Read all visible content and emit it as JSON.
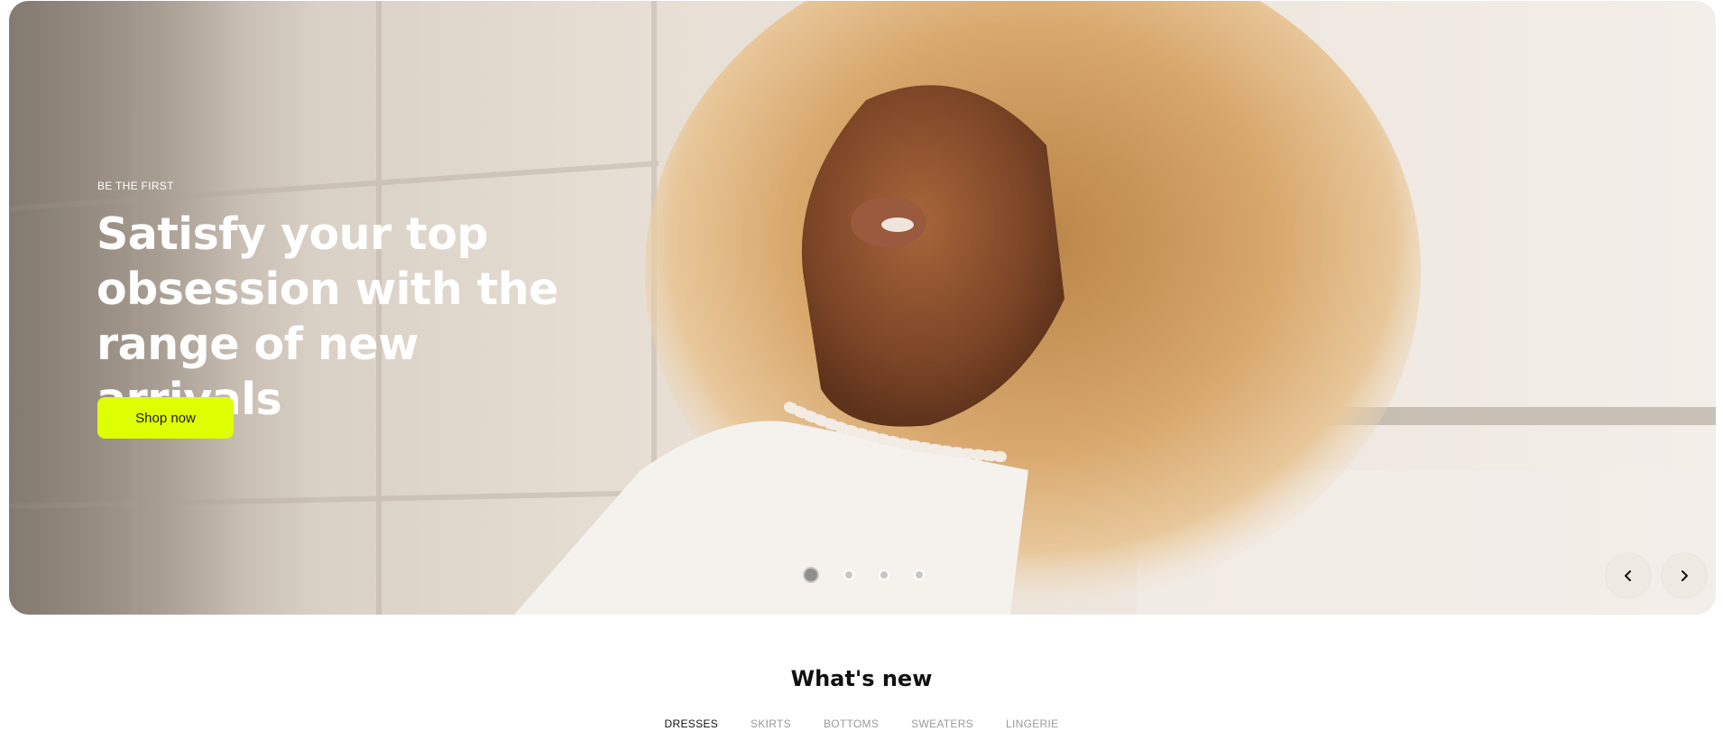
{
  "hero": {
    "eyebrow": "BE THE FIRST",
    "headline": "Satisfy your top obsession with the range of new arrivals",
    "cta_label": "Shop now",
    "cta_color": "#ddff00",
    "slide_count": 4,
    "active_slide": 1,
    "prev_icon": "chevron-left-icon",
    "next_icon": "chevron-right-icon"
  },
  "whats_new": {
    "title": "What's new",
    "tabs": [
      {
        "label": "DRESSES",
        "active": true
      },
      {
        "label": "SKIRTS",
        "active": false
      },
      {
        "label": "BOTTOMS",
        "active": false
      },
      {
        "label": "SWEATERS",
        "active": false
      },
      {
        "label": "LINGERIE",
        "active": false
      }
    ]
  }
}
